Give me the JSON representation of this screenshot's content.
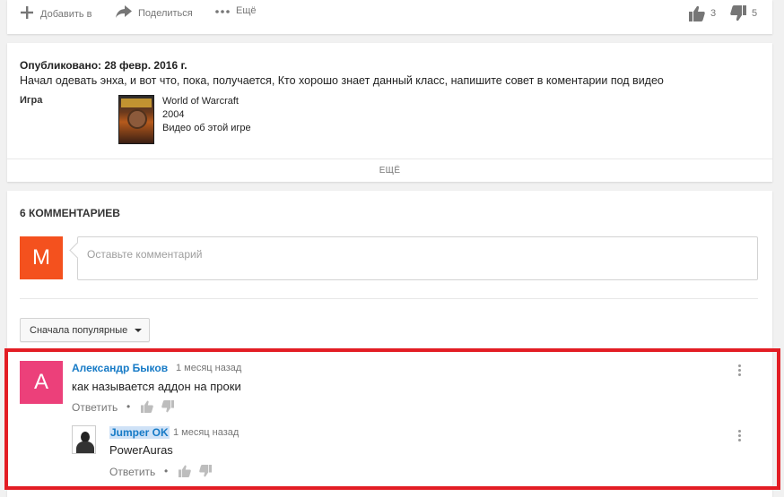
{
  "actions": {
    "add_label": "Добавить в",
    "share_label": "Поделиться",
    "more_label": "Ещё",
    "likes": "3",
    "dislikes": "5"
  },
  "description": {
    "published": "Опубликовано: 28 февр. 2016 г.",
    "text": "Начал одевать энха, и вот что, пока, получается, Кто хорошо знает данный класс, напишите совет в коментарии под видео",
    "meta_label": "Игра",
    "game": {
      "title": "World of Warcraft",
      "year": "2004",
      "link": "Видео об этой игре"
    },
    "more_button": "ЕЩЁ"
  },
  "comments": {
    "count_label": "6 КОММЕНТАРИЕВ",
    "my_avatar_letter": "M",
    "input_placeholder": "Оставьте комментарий",
    "sort_label": "Сначала популярные",
    "items": [
      {
        "avatar_letter": "А",
        "author": "Александр Быков",
        "time": "1 месяц назад",
        "text": "как называется аддон на проки",
        "reply_label": "Ответить",
        "replies": [
          {
            "author": "Jumper OK",
            "time": "1 месяц назад",
            "text": "PowerAuras",
            "reply_label": "Ответить"
          }
        ]
      }
    ]
  },
  "colors": {
    "link": "#167ac6",
    "my_avatar_bg": "#f4511e",
    "comment_avatar_bg": "#ec407a",
    "highlight": "#e31d24"
  }
}
